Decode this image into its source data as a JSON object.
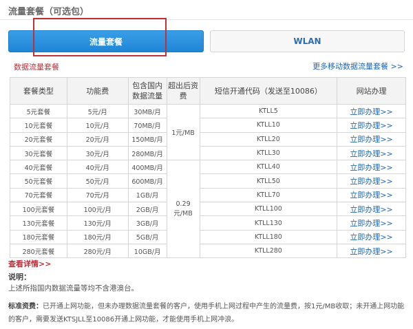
{
  "page_title": "流量套餐（可选包）",
  "tabs": [
    {
      "label": "流量套餐",
      "active": true
    },
    {
      "label": "WLAN",
      "active": false
    }
  ],
  "subheader": {
    "left": "数据流量套餐",
    "right": "更多移动数据流量套餐 >>"
  },
  "table": {
    "headers": [
      "套餐类型",
      "功能费",
      "包含国内\n数据流量",
      "超出后资\n费",
      "短信开通代码（发送至10086）",
      "网站办理"
    ],
    "overage_groups": [
      "1元/MB",
      "0.29元/MB"
    ],
    "action_label": "立即办理>>",
    "rows": [
      {
        "type": "5元套餐",
        "fee": "5元/月",
        "data": "30MB/月",
        "code": "KTLL5"
      },
      {
        "type": "10元套餐",
        "fee": "10元/月",
        "data": "70MB/月",
        "code": "KTLL10"
      },
      {
        "type": "20元套餐",
        "fee": "20元/月",
        "data": "150MB/月",
        "code": "KTLL20"
      },
      {
        "type": "30元套餐",
        "fee": "30元/月",
        "data": "280MB/月",
        "code": "KTLL30"
      },
      {
        "type": "40元套餐",
        "fee": "40元/月",
        "data": "400MB/月",
        "code": "KTLL40"
      },
      {
        "type": "50元套餐",
        "fee": "50元/月",
        "data": "600MB/月",
        "code": "KTLL50"
      },
      {
        "type": "70元套餐",
        "fee": "70元/月",
        "data": "1GB/月",
        "code": "KTLL70"
      },
      {
        "type": "100元套餐",
        "fee": "100元/月",
        "data": "2GB/月",
        "code": "KTLL100"
      },
      {
        "type": "130元套餐",
        "fee": "130元/月",
        "data": "3GB/月",
        "code": "KTLL130"
      },
      {
        "type": "180元套餐",
        "fee": "180元/月",
        "data": "5GB/月",
        "code": "KTLL180"
      },
      {
        "type": "280元套餐",
        "fee": "280元/月",
        "data": "10GB/月",
        "code": "KTLL280"
      }
    ]
  },
  "see_more": "查看详情>>",
  "note": {
    "title": "说明：",
    "text": "上述所指国内数据流量等均不含港澳台。"
  },
  "standard_fee": {
    "label": "标准资费：",
    "text": "已开通上网功能，但未办理数据流量套餐的客户，使用手机上网过程中产生的流量费，按1元/MB收取；未开通上网功能的客户，需要发送KTSJLL至10086开通上网功能，才能使用手机上网冲浪。"
  }
}
